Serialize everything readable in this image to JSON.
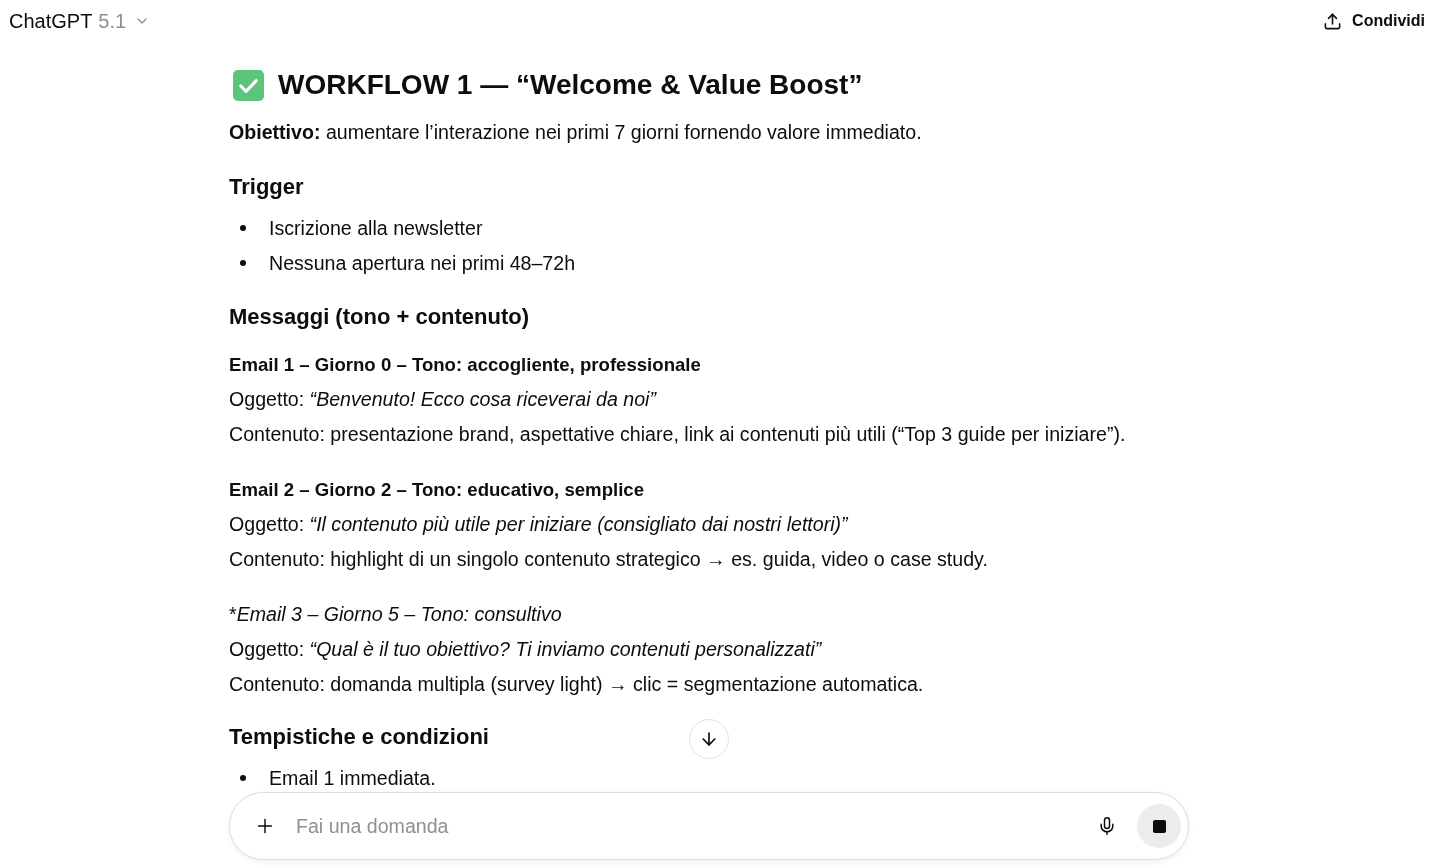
{
  "header": {
    "model_name": "ChatGPT",
    "model_version": "5.1",
    "share_button": "Condividi"
  },
  "message": {
    "title": "WORKFLOW 1 — “Welcome & Value Boost”",
    "objective": "**Obiettivo:** aumentare l’interazione nei primi 7 giorni fornendo valore immediato.",
    "sections": [
      {
        "heading": "Trigger",
        "kind": "bullets",
        "bullets": [
          "Iscrizione alla newsletter",
          "Nessuna apertura nei primi 48–72h"
        ]
      },
      {
        "heading": "Messaggi (tono + contenuto)",
        "kind": "emails",
        "emails": [
          {
            "kind": "bold",
            "title": "Email 1 – Giorno 0 – Tono: accogliente, professionale",
            "subject": "Oggetto: *“Benvenuto! Ecco cosa riceverai da noi”*",
            "content": "Contenuto: presentazione brand, aspettative chiare, link ai contenuti più utili (“Top 3 guide per iniziare”)."
          },
          {
            "kind": "bold",
            "title": "Email 2 – Giorno 2 – Tono: educativo, semplice",
            "subject": "Oggetto: *“Il contenuto più utile per iniziare (consigliato dai nostri lettori)”*",
            "content": "Contenuto: highlight di un singolo contenuto strategico → es. guida, video o case study."
          },
          {
            "kind": "italic",
            "title_prefix": "*",
            "title": "Email 3 – Giorno 5 – Tono: consultivo",
            "subject": "Oggetto: *“Qual è il tuo obiettivo? Ti inviamo contenuti personalizzati”*",
            "content": "Contenuto: domanda multipla (survey light) → clic = segmentazione automatica."
          }
        ]
      },
      {
        "heading": "Tempistiche e condizioni",
        "kind": "bullets",
        "bullets": [
          "Email 1 immediata."
        ]
      }
    ]
  },
  "composer": {
    "placeholder": "Fai una domanda"
  }
}
